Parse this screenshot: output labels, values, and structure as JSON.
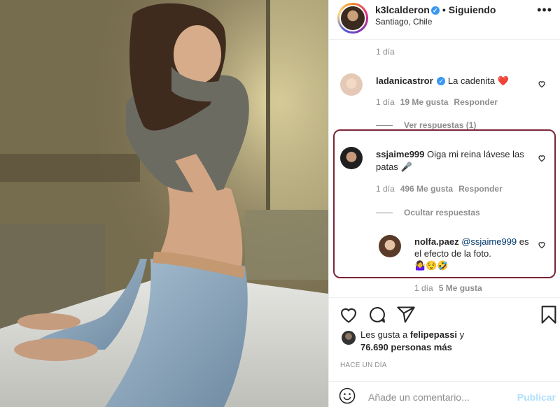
{
  "header": {
    "username": "k3lcalderon",
    "dot": "•",
    "follow_status": "Siguiendo",
    "location": "Santiago, Chile",
    "more": "•••"
  },
  "caption_time": "1 día",
  "comments": [
    {
      "username": "ladanicastror",
      "text": "La cadenita",
      "emoji": "❤️",
      "time": "1 día",
      "likes": "19 Me gusta",
      "reply": "Responder",
      "replies_toggle": "Ver respuestas (1)"
    },
    {
      "username": "ssjaime999",
      "text": "Oiga mi reina lávese las patas",
      "emoji": "🎤",
      "time": "1 día",
      "likes": "496 Me gusta",
      "reply": "Responder",
      "replies_toggle": "Ocultar respuestas",
      "replies": [
        {
          "username": "nolfa.paez",
          "mention": "@ssjaime999",
          "text": "es el efecto de la foto.",
          "emoji": "🤷‍♀️😌🤣",
          "time": "1 día",
          "likes": "5 Me gusta"
        }
      ]
    }
  ],
  "likes_summary": {
    "prefix": "Les gusta a",
    "user": "felipepassi",
    "suffix": "y",
    "others": "76.690 personas más"
  },
  "time_ago": "HACE UN DÍA",
  "composer": {
    "placeholder": "Añade un comentario...",
    "publish": "Publicar"
  },
  "colors": {
    "highlight_border": "#7b2636",
    "link": "#00376b",
    "muted": "#8e8e8e",
    "publish_disabled": "#b2dffc",
    "verified": "#3897f0",
    "heart": "#ed4956"
  }
}
